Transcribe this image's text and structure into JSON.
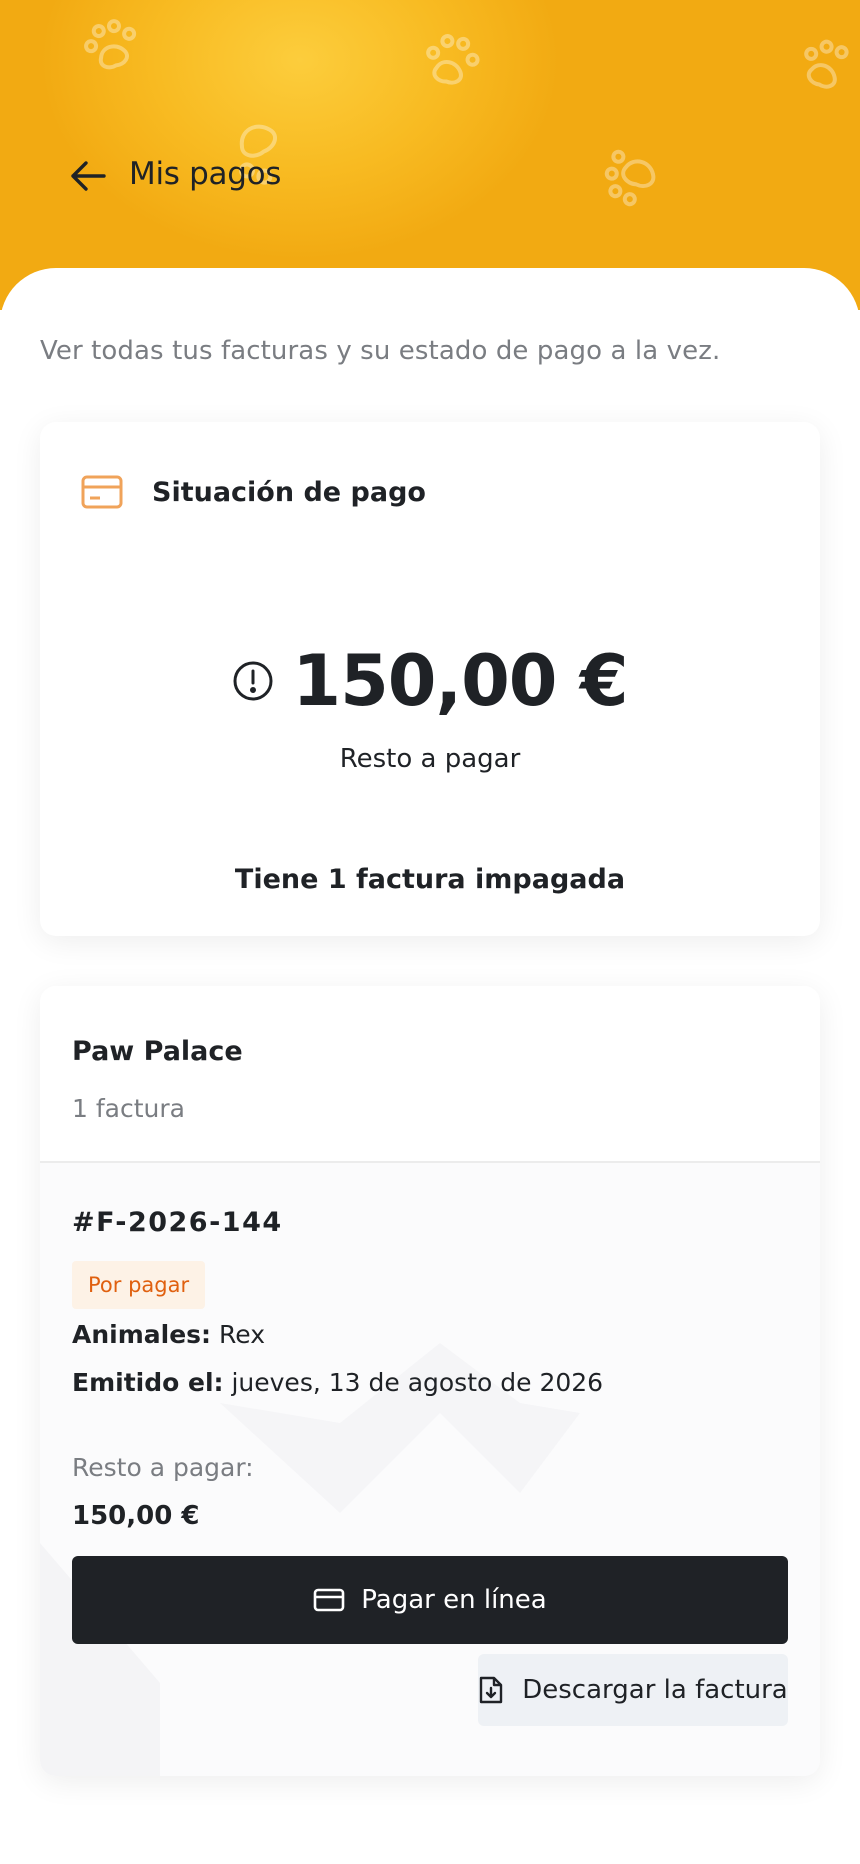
{
  "header": {
    "title": "Mis pagos"
  },
  "icons": {
    "back": "arrow-left-icon",
    "card": "credit-card-icon",
    "alert": "alert-circle-icon",
    "download": "file-download-icon",
    "paw": "paw-icon"
  },
  "colors": {
    "header_yellow": "#f8bb22",
    "accent_orange": "#f0a35a",
    "badge_text": "#e0600f",
    "badge_bg": "#fdf2e6",
    "primary_button": "#1f2226",
    "secondary_button": "#eef1f5"
  },
  "intro": "Ver todas tus facturas y su estado de pago a la vez.",
  "payment_status": {
    "title": "Situación de pago",
    "amount": "150,00 €",
    "amount_label": "Resto a pagar",
    "unpaid_summary": "Tiene 1 factura impagada"
  },
  "clinic": {
    "name": "Paw Palace",
    "invoice_count": "1 factura",
    "invoice": {
      "number": "#F-2026-144",
      "status": "Por pagar",
      "animals_label": "Animales:",
      "animals_value": "Rex",
      "issued_label": "Emitido el:",
      "issued_value": "jueves, 13 de agosto de 2026",
      "due_label": "Resto a pagar:",
      "due_amount": "150,00 €",
      "pay_button": "Pagar en línea",
      "download_button": "Descargar la factura"
    }
  }
}
